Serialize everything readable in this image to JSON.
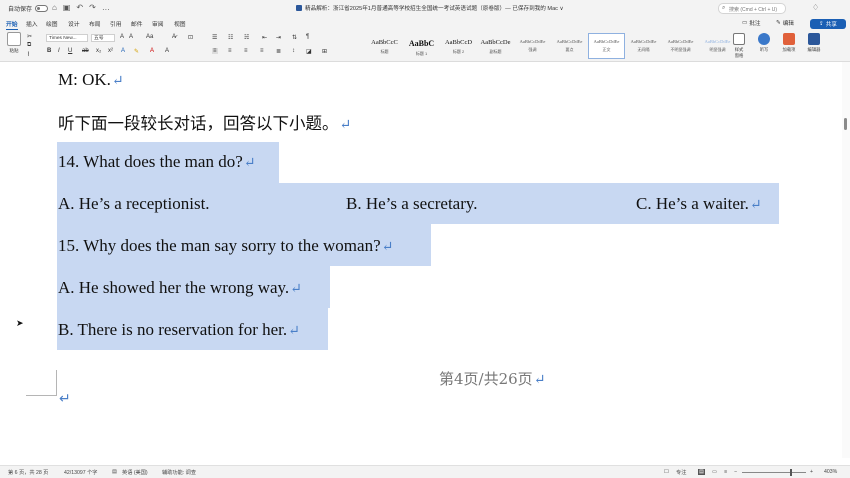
{
  "titlebar": {
    "autosave_label": "自动保存",
    "doc_title": "精品解析：浙江省2025年1月普通高等学校招生全国统一考试英语试题（原卷版）— 已保存到我的 Mac ∨",
    "search_placeholder": "搜索 (Cmd + Ctrl + U)"
  },
  "tabs": {
    "items": [
      "开始",
      "插入",
      "绘图",
      "设计",
      "布局",
      "引用",
      "邮件",
      "审阅",
      "视图"
    ],
    "comment_label": "批注",
    "edit_label": "编辑",
    "share_label": "共享"
  },
  "ribbon": {
    "paste_label": "粘贴",
    "font_name": "Times New...",
    "font_size": "五号",
    "styles": [
      {
        "sample": "AaBbCcC",
        "name": "标题"
      },
      {
        "sample": "AaBbC",
        "name": "标题 1"
      },
      {
        "sample": "AaBbCcD",
        "name": "标题 2"
      },
      {
        "sample": "AaBbCcDe",
        "name": "副标题"
      },
      {
        "sample": "AaBbCcDdEe",
        "name": "强调"
      },
      {
        "sample": "AaBbCcDdEe",
        "name": "要点"
      },
      {
        "sample": "AaBbCcDdEe",
        "name": "正文"
      },
      {
        "sample": "AaBbCcDdEe",
        "name": "无间隔"
      },
      {
        "sample": "AaBbCcDdEe",
        "name": "不明显强调"
      },
      {
        "sample": "AaBbCcDdEe",
        "name": "明显强调"
      }
    ],
    "styles_pane_label": "样式\n窗格",
    "dictate_label": "听写",
    "addins_label": "加载项",
    "editor_label": "编辑器"
  },
  "document": {
    "line1": "M: OK.",
    "line2": "听下面一段较长对话，回答以下小题。",
    "q14": "14. What does the man do?",
    "q14_a": "A. He’s a receptionist.",
    "q14_b": "B. He’s a secretary.",
    "q14_c": "C. He’s a waiter.",
    "q15": "15. Why does the man say sorry to the woman?",
    "q15_a": "A. He showed her the wrong way.",
    "q15_b": "B. There is no reservation for her.",
    "footer": "第4页/共26页",
    "para_mark": "↵"
  },
  "statusbar": {
    "page_info": "第 6 页，共 28 页",
    "word_count": "42/13097 个字",
    "language": "英语 (美国)",
    "accessibility": "辅助功能: 调查",
    "focus_label": "专注",
    "zoom": "403%"
  }
}
